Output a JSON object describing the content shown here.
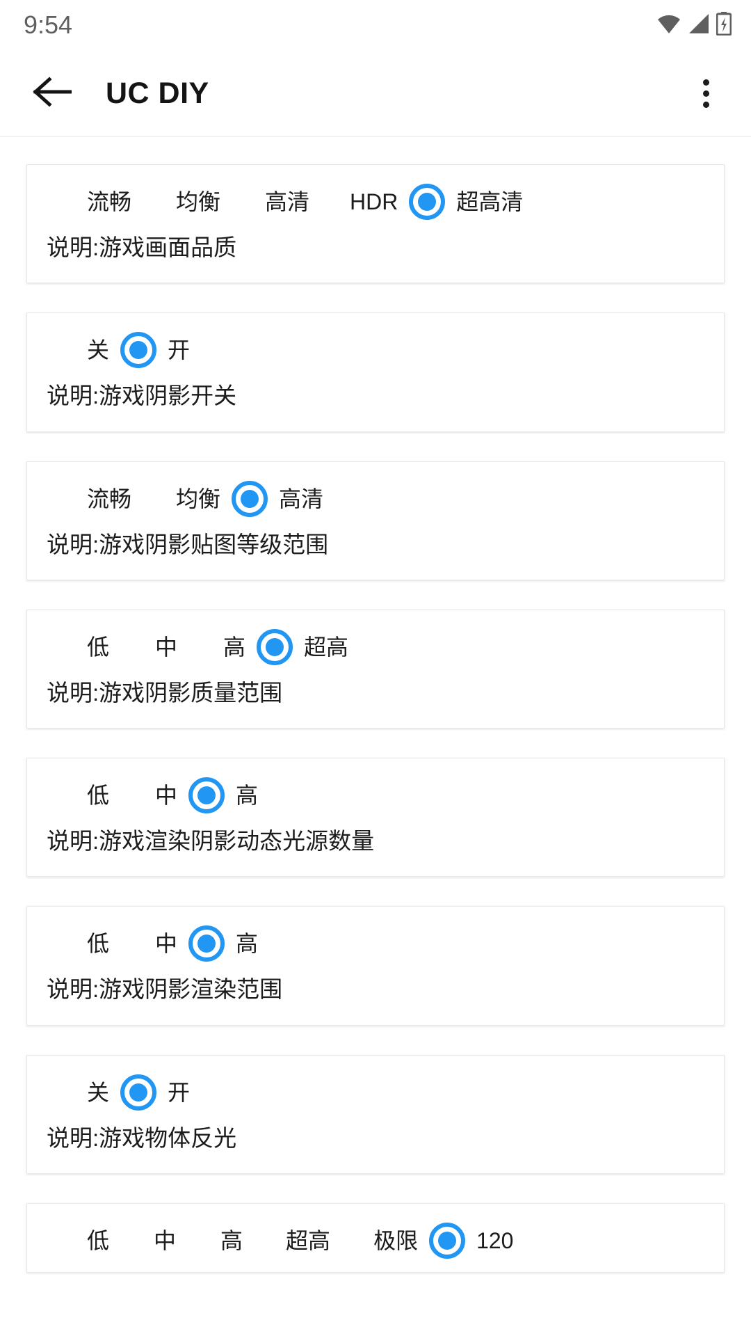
{
  "status_bar": {
    "time": "9:54",
    "icons": [
      "wifi-icon",
      "signal-icon",
      "battery-charging-icon"
    ]
  },
  "app_bar": {
    "back_icon": "back-arrow-icon",
    "title": "UC DIY",
    "overflow_icon": "overflow-menu-icon"
  },
  "theme": {
    "accent": "#2196f3",
    "background": "#ffffff",
    "card_background": "#ffffff",
    "text": "#1c1c1c",
    "status_text": "#5f5f5f"
  },
  "cards": [
    {
      "options": [
        "流畅",
        "均衡",
        "高清",
        "HDR",
        "超高清"
      ],
      "selected_index": 4,
      "description": "说明:游戏画面品质",
      "gaps": [
        0,
        64,
        64,
        58,
        0
      ]
    },
    {
      "options": [
        "关",
        "开"
      ],
      "selected_index": 1,
      "description": "说明:游戏阴影开关",
      "gaps": [
        0,
        0
      ]
    },
    {
      "options": [
        "流畅",
        "均衡",
        "高清"
      ],
      "selected_index": 2,
      "description": "说明:游戏阴影贴图等级范围",
      "gaps": [
        0,
        64,
        0
      ]
    },
    {
      "options": [
        "低",
        "中",
        "高",
        "超高"
      ],
      "selected_index": 3,
      "description": "说明:游戏阴影质量范围",
      "gaps": [
        0,
        66,
        66,
        0
      ]
    },
    {
      "options": [
        "低",
        "中",
        "高"
      ],
      "selected_index": 2,
      "description": "说明:游戏渲染阴影动态光源数量",
      "gaps": [
        0,
        66,
        0
      ]
    },
    {
      "options": [
        "低",
        "中",
        "高"
      ],
      "selected_index": 2,
      "description": "说明:游戏阴影渲染范围",
      "gaps": [
        0,
        66,
        0
      ]
    },
    {
      "options": [
        "关",
        "开"
      ],
      "selected_index": 1,
      "description": "说明:游戏物体反光",
      "gaps": [
        0,
        0
      ]
    },
    {
      "options": [
        "低",
        "中",
        "高",
        "超高",
        "极限",
        "120"
      ],
      "selected_index": 5,
      "description": "",
      "gaps": [
        0,
        64,
        64,
        62,
        62,
        0
      ]
    }
  ]
}
